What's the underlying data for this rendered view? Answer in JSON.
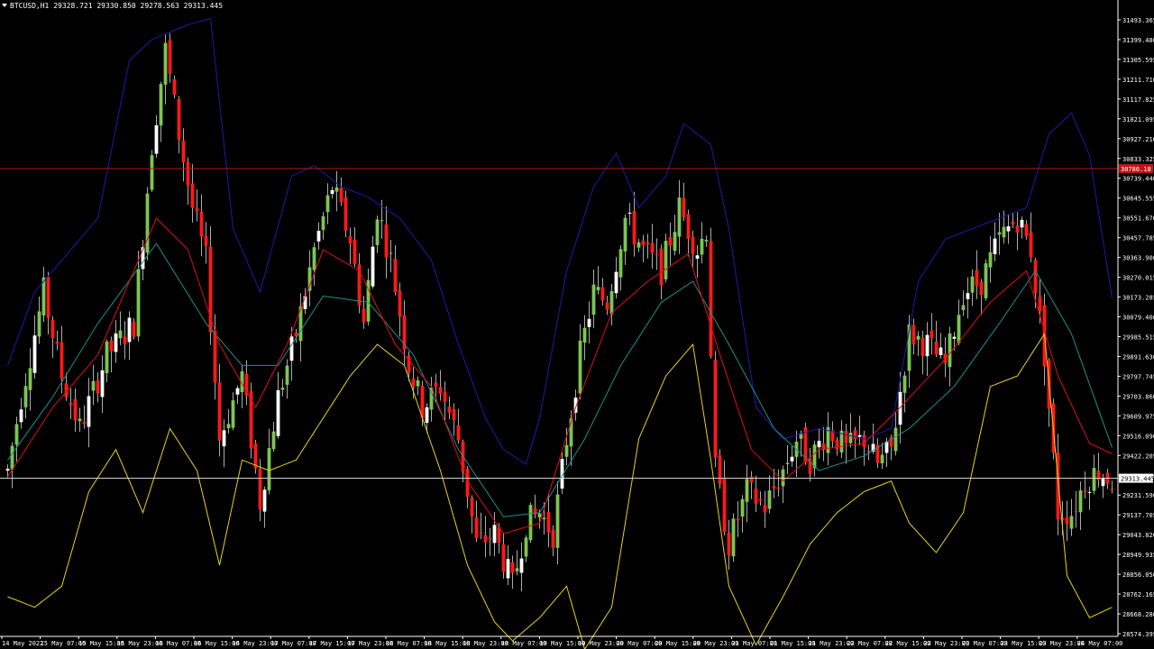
{
  "chart_data": {
    "type": "candlestick",
    "symbol": "BTCUSD,H1",
    "ohlc_readout": "29328.721 29330.850 29278.563 29313.445",
    "current_price": 29313.445,
    "current_price_label": "29313.445",
    "red_line_price": 30786.18,
    "red_line_label": "30786.18",
    "ylim": [
      28574.29,
      31506.0
    ],
    "y_ticks": [
      "31493.365",
      "31399.480",
      "31305.595",
      "31211.710",
      "31117.825",
      "31021.095",
      "30927.210",
      "30833.325",
      "30739.440",
      "30645.555",
      "30551.670",
      "30457.785",
      "30363.900",
      "30270.015",
      "30173.285",
      "30079.400",
      "29985.515",
      "29891.630",
      "29797.745",
      "29703.860",
      "29609.975",
      "29516.090",
      "29422.205",
      "29328.320",
      "29231.590",
      "29137.705",
      "29043.820",
      "28949.935",
      "28856.050",
      "28762.165",
      "28668.280",
      "28574.395"
    ],
    "x_ticks": [
      "14 May 2022",
      "15 May 07:00",
      "15 May 15:00",
      "15 May 23:00",
      "16 May 07:00",
      "16 May 15:00",
      "16 May 23:00",
      "17 May 07:00",
      "17 May 15:00",
      "17 May 23:00",
      "18 May 07:00",
      "18 May 15:00",
      "18 May 23:00",
      "19 May 07:00",
      "19 May 15:00",
      "19 May 23:00",
      "20 May 07:00",
      "20 May 15:00",
      "20 May 23:00",
      "21 May 07:00",
      "21 May 15:00",
      "21 May 23:00",
      "22 May 07:00",
      "22 May 15:00",
      "22 May 23:00",
      "23 May 07:00",
      "23 May 15:00",
      "23 May 23:00",
      "24 May 07:00"
    ],
    "candle_anchors": [
      [
        0,
        29350
      ],
      [
        3,
        29700
      ],
      [
        8,
        30200
      ],
      [
        12,
        29800
      ],
      [
        16,
        29550
      ],
      [
        22,
        29900
      ],
      [
        28,
        30050
      ],
      [
        32,
        30900
      ],
      [
        35,
        31350
      ],
      [
        38,
        30950
      ],
      [
        41,
        30600
      ],
      [
        44,
        30350
      ],
      [
        47,
        29500
      ],
      [
        52,
        29800
      ],
      [
        56,
        29200
      ],
      [
        60,
        29700
      ],
      [
        64,
        30000
      ],
      [
        68,
        30400
      ],
      [
        72,
        30700
      ],
      [
        76,
        30450
      ],
      [
        79,
        30050
      ],
      [
        82,
        30600
      ],
      [
        85,
        30350
      ],
      [
        89,
        29850
      ],
      [
        92,
        29650
      ],
      [
        96,
        29750
      ],
      [
        100,
        29500
      ],
      [
        104,
        29000
      ],
      [
        108,
        29050
      ],
      [
        112,
        28800
      ],
      [
        115,
        29100
      ],
      [
        118,
        29150
      ],
      [
        121,
        29050
      ],
      [
        124,
        29500
      ],
      [
        127,
        29900
      ],
      [
        130,
        30200
      ],
      [
        133,
        30150
      ],
      [
        137,
        30550
      ],
      [
        141,
        30400
      ],
      [
        145,
        30300
      ],
      [
        149,
        30600
      ],
      [
        153,
        30400
      ],
      [
        155,
        30500
      ],
      [
        157,
        29350
      ],
      [
        160,
        29000
      ],
      [
        164,
        29250
      ],
      [
        168,
        29180
      ],
      [
        172,
        29350
      ],
      [
        175,
        29500
      ],
      [
        178,
        29400
      ],
      [
        182,
        29550
      ],
      [
        186,
        29450
      ],
      [
        190,
        29500
      ],
      [
        193,
        29380
      ],
      [
        196,
        29450
      ],
      [
        200,
        30000
      ],
      [
        204,
        29950
      ],
      [
        208,
        29850
      ],
      [
        212,
        30200
      ],
      [
        216,
        30250
      ],
      [
        220,
        30450
      ],
      [
        224,
        30550
      ],
      [
        227,
        30400
      ],
      [
        230,
        29900
      ],
      [
        233,
        29150
      ],
      [
        236,
        29150
      ],
      [
        239,
        29300
      ],
      [
        242,
        29350
      ],
      [
        245,
        29300
      ]
    ],
    "ema_fast": [
      [
        0,
        29320
      ],
      [
        10,
        29650
      ],
      [
        20,
        29900
      ],
      [
        33,
        30550
      ],
      [
        40,
        30400
      ],
      [
        47,
        29950
      ],
      [
        55,
        29650
      ],
      [
        62,
        29950
      ],
      [
        70,
        30400
      ],
      [
        78,
        30300
      ],
      [
        86,
        29950
      ],
      [
        94,
        29750
      ],
      [
        102,
        29300
      ],
      [
        110,
        29050
      ],
      [
        118,
        29100
      ],
      [
        126,
        29650
      ],
      [
        134,
        30100
      ],
      [
        142,
        30250
      ],
      [
        151,
        30380
      ],
      [
        158,
        29900
      ],
      [
        165,
        29450
      ],
      [
        172,
        29300
      ],
      [
        180,
        29450
      ],
      [
        190,
        29480
      ],
      [
        198,
        29650
      ],
      [
        208,
        29880
      ],
      [
        218,
        30150
      ],
      [
        226,
        30300
      ],
      [
        233,
        29800
      ],
      [
        240,
        29480
      ],
      [
        245,
        29430
      ]
    ],
    "ema_slow": [
      [
        0,
        29400
      ],
      [
        10,
        29700
      ],
      [
        20,
        30050
      ],
      [
        33,
        30430
      ],
      [
        44,
        30050
      ],
      [
        52,
        29850
      ],
      [
        60,
        29850
      ],
      [
        70,
        30180
      ],
      [
        80,
        30150
      ],
      [
        90,
        29900
      ],
      [
        100,
        29450
      ],
      [
        110,
        29130
      ],
      [
        118,
        29150
      ],
      [
        128,
        29500
      ],
      [
        136,
        29850
      ],
      [
        145,
        30150
      ],
      [
        152,
        30250
      ],
      [
        160,
        29950
      ],
      [
        170,
        29550
      ],
      [
        180,
        29350
      ],
      [
        190,
        29420
      ],
      [
        200,
        29550
      ],
      [
        210,
        29750
      ],
      [
        220,
        30050
      ],
      [
        228,
        30300
      ],
      [
        236,
        30000
      ],
      [
        245,
        29460
      ]
    ],
    "bb_upper": [
      [
        0,
        29850
      ],
      [
        6,
        30200
      ],
      [
        12,
        30350
      ],
      [
        20,
        30550
      ],
      [
        27,
        31300
      ],
      [
        32,
        31400
      ],
      [
        40,
        31470
      ],
      [
        45,
        31500
      ],
      [
        50,
        30500
      ],
      [
        56,
        30200
      ],
      [
        63,
        30750
      ],
      [
        68,
        30800
      ],
      [
        74,
        30700
      ],
      [
        80,
        30650
      ],
      [
        87,
        30550
      ],
      [
        94,
        30350
      ],
      [
        100,
        29950
      ],
      [
        106,
        29600
      ],
      [
        110,
        29450
      ],
      [
        115,
        29380
      ],
      [
        118,
        29600
      ],
      [
        124,
        30300
      ],
      [
        130,
        30700
      ],
      [
        135,
        30860
      ],
      [
        140,
        30600
      ],
      [
        146,
        30750
      ],
      [
        150,
        31000
      ],
      [
        156,
        30900
      ],
      [
        160,
        30500
      ],
      [
        166,
        29650
      ],
      [
        172,
        29500
      ],
      [
        180,
        29550
      ],
      [
        190,
        29500
      ],
      [
        196,
        29550
      ],
      [
        202,
        30250
      ],
      [
        208,
        30450
      ],
      [
        214,
        30500
      ],
      [
        220,
        30550
      ],
      [
        226,
        30600
      ],
      [
        231,
        30950
      ],
      [
        236,
        31050
      ],
      [
        240,
        30850
      ],
      [
        245,
        30170
      ]
    ],
    "bb_lower": [
      [
        0,
        28750
      ],
      [
        6,
        28700
      ],
      [
        12,
        28800
      ],
      [
        18,
        29250
      ],
      [
        24,
        29450
      ],
      [
        30,
        29150
      ],
      [
        36,
        29550
      ],
      [
        42,
        29350
      ],
      [
        47,
        28900
      ],
      [
        52,
        29400
      ],
      [
        58,
        29350
      ],
      [
        64,
        29400
      ],
      [
        70,
        29600
      ],
      [
        76,
        29800
      ],
      [
        82,
        29950
      ],
      [
        88,
        29850
      ],
      [
        96,
        29350
      ],
      [
        102,
        28900
      ],
      [
        108,
        28630
      ],
      [
        112,
        28540
      ],
      [
        118,
        28650
      ],
      [
        124,
        28800
      ],
      [
        128,
        28500
      ],
      [
        134,
        28700
      ],
      [
        140,
        29500
      ],
      [
        146,
        29800
      ],
      [
        152,
        29950
      ],
      [
        156,
        29400
      ],
      [
        160,
        28800
      ],
      [
        166,
        28520
      ],
      [
        172,
        28750
      ],
      [
        178,
        29000
      ],
      [
        184,
        29150
      ],
      [
        190,
        29250
      ],
      [
        196,
        29300
      ],
      [
        200,
        29100
      ],
      [
        206,
        28960
      ],
      [
        212,
        29150
      ],
      [
        218,
        29750
      ],
      [
        224,
        29800
      ],
      [
        230,
        30000
      ],
      [
        235,
        28850
      ],
      [
        240,
        28650
      ],
      [
        245,
        28700
      ]
    ]
  }
}
